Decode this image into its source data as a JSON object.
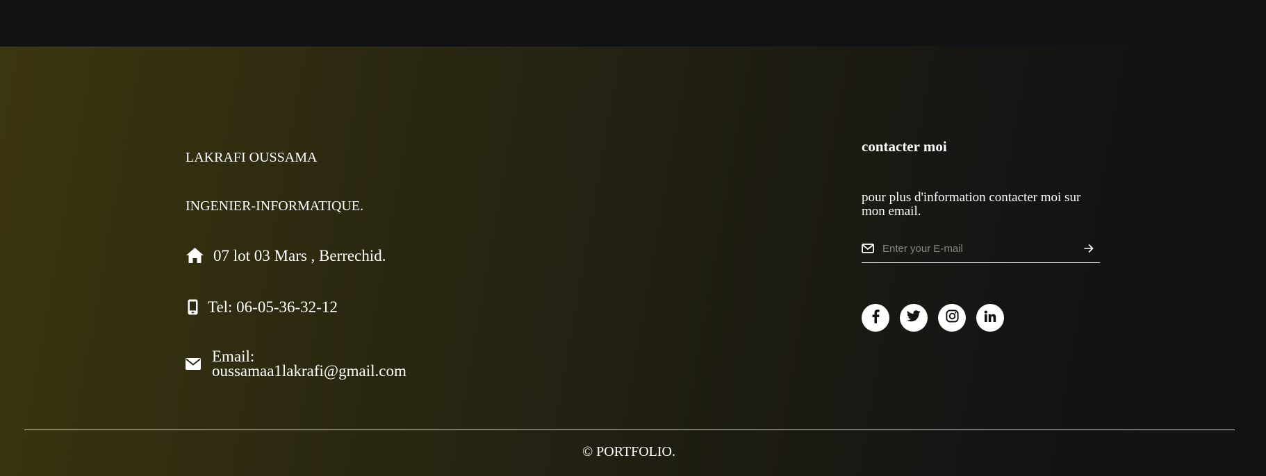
{
  "profile": {
    "name": "LAKRAFI OUSSAMA",
    "title": "INGENIER-INFORMATIQUE.",
    "address": "07 lot 03 Mars , Berrechid.",
    "phone": "Tel: 06-05-36-32-12",
    "email_label": "Email:",
    "email": "oussamaa1lakrafi@gmail.com"
  },
  "contact": {
    "heading": "contacter moi",
    "text": "pour plus d'information contacter moi sur mon email.",
    "email_placeholder": "Enter your E-mail"
  },
  "socials": [
    {
      "name": "facebook",
      "icon": "facebook-icon"
    },
    {
      "name": "twitter",
      "icon": "twitter-icon"
    },
    {
      "name": "instagram",
      "icon": "instagram-icon"
    },
    {
      "name": "linkedin",
      "icon": "linkedin-icon"
    }
  ],
  "footer": {
    "copyright": "© PORTFOLIO."
  },
  "colors": {
    "page_bg": "#111214",
    "gradient_start": "#3b3610",
    "gradient_end": "#111111",
    "text": "#ffffff",
    "placeholder": "#8a8a84"
  }
}
